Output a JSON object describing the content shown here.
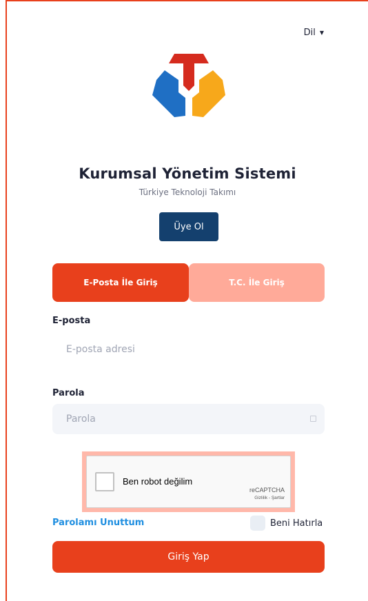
{
  "header": {
    "language_label": "Dil"
  },
  "brand": {
    "title": "Kurumsal Yönetim Sistemi",
    "subtitle": "Türkiye Teknoloji Takımı",
    "colors": {
      "red": "#d52b1e",
      "blue": "#1f6fc4",
      "yellow": "#f7a81b"
    }
  },
  "signup_label": "Üye Ol",
  "tabs": [
    {
      "label": "E-Posta İle Giriş",
      "active": true
    },
    {
      "label": "T.C. İle Giriş",
      "active": false
    }
  ],
  "form": {
    "email_label": "E-posta",
    "email_placeholder": "E-posta adresi",
    "password_label": "Parola",
    "password_placeholder": "Parola",
    "password_toggle_icon": "eye-icon"
  },
  "captcha": {
    "label": "Ben robot değilim",
    "brand": "reCAPTCHA",
    "terms": "Gizlilik - Şartlar"
  },
  "forgot_label": "Parolamı Unuttum",
  "remember_label": "Beni Hatırla",
  "login_label": "Giriş Yap",
  "colors": {
    "accent": "#e8401c",
    "accent_light": "#ffaa99",
    "navy": "#14406e",
    "link": "#1e8ee0"
  }
}
